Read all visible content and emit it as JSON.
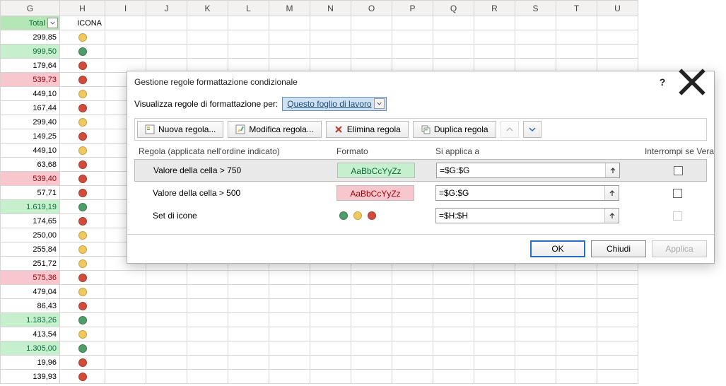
{
  "sheet": {
    "columns": [
      "G",
      "H",
      "I",
      "J",
      "K",
      "L",
      "M",
      "N",
      "O",
      "P",
      "Q",
      "R",
      "S",
      "T",
      "U"
    ],
    "headerRow": {
      "total": "Total",
      "icona": "ICONA"
    },
    "rows": [
      {
        "value": "299,85",
        "fmt": "",
        "icon": "yellow"
      },
      {
        "value": "999,50",
        "fmt": "green",
        "icon": "green"
      },
      {
        "value": "179,64",
        "fmt": "",
        "icon": "red"
      },
      {
        "value": "539,73",
        "fmt": "red",
        "icon": "red"
      },
      {
        "value": "449,10",
        "fmt": "",
        "icon": "yellow"
      },
      {
        "value": "167,44",
        "fmt": "",
        "icon": "red"
      },
      {
        "value": "299,40",
        "fmt": "",
        "icon": "yellow"
      },
      {
        "value": "149,25",
        "fmt": "",
        "icon": "red"
      },
      {
        "value": "449,10",
        "fmt": "",
        "icon": "yellow"
      },
      {
        "value": "63,68",
        "fmt": "",
        "icon": "red"
      },
      {
        "value": "539,40",
        "fmt": "red",
        "icon": "red"
      },
      {
        "value": "57,71",
        "fmt": "",
        "icon": "red"
      },
      {
        "value": "1.619,19",
        "fmt": "green",
        "icon": "green"
      },
      {
        "value": "174,65",
        "fmt": "",
        "icon": "red"
      },
      {
        "value": "250,00",
        "fmt": "",
        "icon": "yellow"
      },
      {
        "value": "255,84",
        "fmt": "",
        "icon": "yellow"
      },
      {
        "value": "251,72",
        "fmt": "",
        "icon": "yellow"
      },
      {
        "value": "575,36",
        "fmt": "red",
        "icon": "red"
      },
      {
        "value": "479,04",
        "fmt": "",
        "icon": "yellow"
      },
      {
        "value": "86,43",
        "fmt": "",
        "icon": "red"
      },
      {
        "value": "1.183,26",
        "fmt": "green",
        "icon": "green"
      },
      {
        "value": "413,54",
        "fmt": "",
        "icon": "yellow"
      },
      {
        "value": "1.305,00",
        "fmt": "green",
        "icon": "green"
      },
      {
        "value": "19,96",
        "fmt": "",
        "icon": "red"
      },
      {
        "value": "139,93",
        "fmt": "",
        "icon": "red"
      }
    ]
  },
  "dialog": {
    "title": "Gestione regole formattazione condizionale",
    "scopeLabel": "Visualizza regole di formattazione per:",
    "scopeValue": "Questo foglio di lavoro",
    "toolbar": {
      "new": "Nuova regola...",
      "edit": "Modifica regola...",
      "delete": "Elimina regola",
      "duplicate": "Duplica regola"
    },
    "columns": {
      "rule": "Regola (applicata nell'ordine indicato)",
      "format": "Formato",
      "applies": "Si applica a",
      "stop": "Interrompi se Vera"
    },
    "rules": [
      {
        "desc": "Valore della cella > 750",
        "sample": "AaBbCcYyZz",
        "sampleClass": "green",
        "range": "=$G:$G",
        "stopEnabled": true
      },
      {
        "desc": "Valore della cella > 500",
        "sample": "AaBbCcYyZz",
        "sampleClass": "red",
        "range": "=$G:$G",
        "stopEnabled": true
      },
      {
        "desc": "Set di icone",
        "sample": "",
        "sampleClass": "iconset",
        "range": "=$H:$H",
        "stopEnabled": false
      }
    ],
    "buttons": {
      "ok": "OK",
      "close": "Chiudi",
      "apply": "Applica"
    }
  }
}
